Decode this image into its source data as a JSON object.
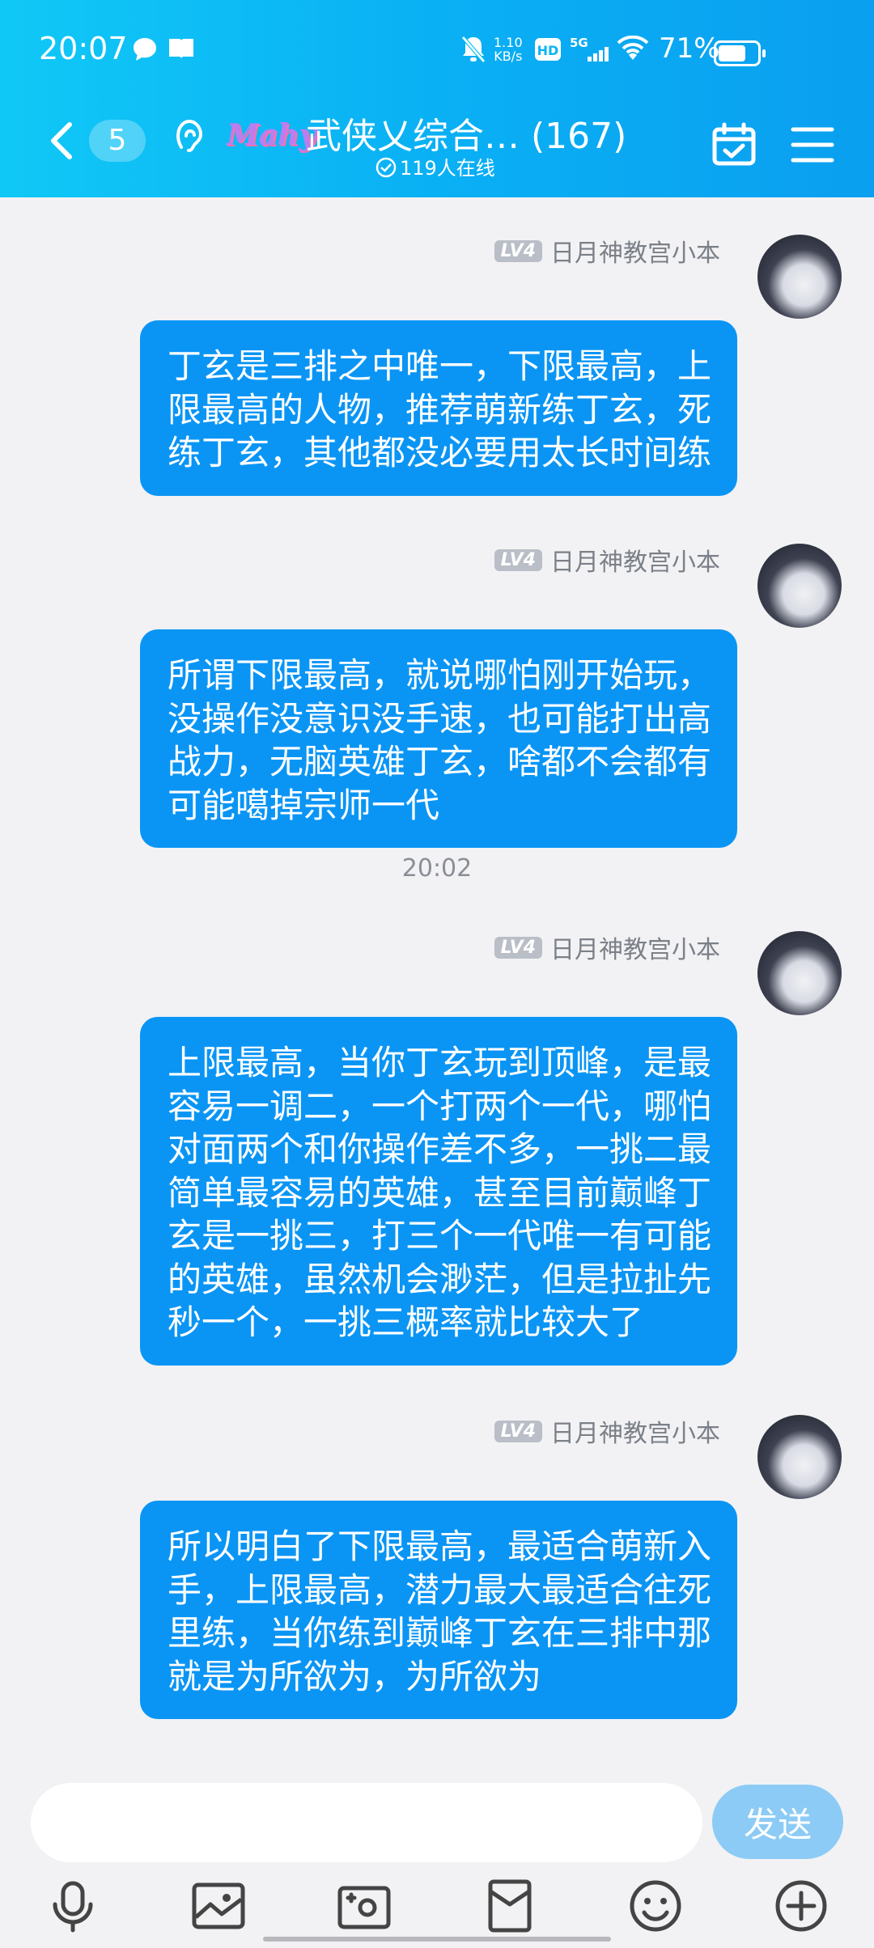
{
  "status_bar": {
    "time": "20:07",
    "net_speed_value": "1.10",
    "net_speed_unit": "KB/s",
    "battery": "71%",
    "icons": [
      "message-icon",
      "book-icon",
      "mute-bell-icon",
      "hd-icon",
      "5g-signal-icon",
      "wifi-icon",
      "battery-icon"
    ]
  },
  "header": {
    "back_icon": "chevron-left-icon",
    "unread_count": "5",
    "logo_text": "Mahy",
    "group_title": "武侠乂综合… (167)",
    "online_text": "119人在线",
    "calendar_icon": "calendar-check-icon",
    "menu_icon": "hamburger-menu-icon"
  },
  "messages": [
    {
      "level": "LV4",
      "sender": "日月神教宫小本",
      "text": "丁玄是三排之中唯一，下限最高，上限最高的人物，推荐萌新练丁玄，死练丁玄，其他都没必要用太长时间练"
    },
    {
      "level": "LV4",
      "sender": "日月神教宫小本",
      "text": "所谓下限最高，就说哪怕刚开始玩，没操作没意识没手速，也可能打出高战力，无脑英雄丁玄，啥都不会都有可能噶掉宗师一代"
    },
    {
      "level": "LV4",
      "sender": "日月神教宫小本",
      "text": "上限最高，当你丁玄玩到顶峰，是最容易一调二，一个打两个一代，哪怕对面两个和你操作差不多，一挑二最简单最容易的英雄，甚至目前巅峰丁玄是一挑三，打三个一代唯一有可能的英雄，虽然机会渺茫，但是拉扯先秒一个，一挑三概率就比较大了"
    },
    {
      "level": "LV4",
      "sender": "日月神教宫小本",
      "text": "所以明白了下限最高，最适合萌新入手，上限最高，潜力最大最适合往死里练，当你练到巅峰丁玄在三排中那就是为所欲为，为所欲为"
    }
  ],
  "timestamp": "20:02",
  "input": {
    "value": "",
    "placeholder": "",
    "send_label": "发送"
  },
  "toolbar": {
    "icons": [
      "microphone-icon",
      "image-icon",
      "camera-icon",
      "red-packet-icon",
      "emoji-icon",
      "plus-icon"
    ]
  },
  "colors": {
    "header_start": "#10c8f6",
    "header_end": "#0a9ff0",
    "bubble": "#0a95f5",
    "send_button": "#8ccbf5",
    "background": "#f2f2f4"
  }
}
